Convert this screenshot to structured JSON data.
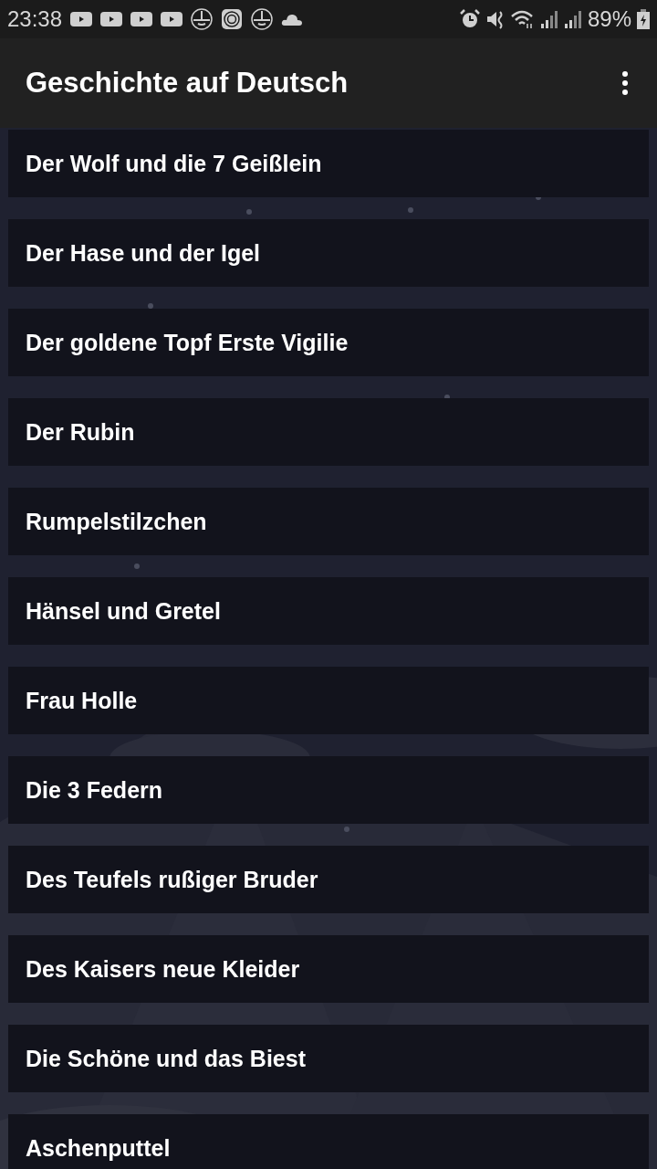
{
  "status_bar": {
    "time": "23:38",
    "battery": "89%"
  },
  "app_bar": {
    "title": "Geschichte auf Deutsch"
  },
  "stories": [
    {
      "title": "Der Wolf und die 7 Geißlein"
    },
    {
      "title": "Der Hase und der Igel"
    },
    {
      "title": "Der goldene Topf Erste Vigilie"
    },
    {
      "title": "Der Rubin"
    },
    {
      "title": "Rumpelstilzchen"
    },
    {
      "title": "Hänsel und Gretel"
    },
    {
      "title": "Frau Holle"
    },
    {
      "title": "Die 3 Federn"
    },
    {
      "title": "Des Teufels rußiger Bruder"
    },
    {
      "title": "Des Kaisers neue Kleider"
    },
    {
      "title": "Die Schöne und das Biest"
    },
    {
      "title": "Aschenputtel"
    }
  ]
}
